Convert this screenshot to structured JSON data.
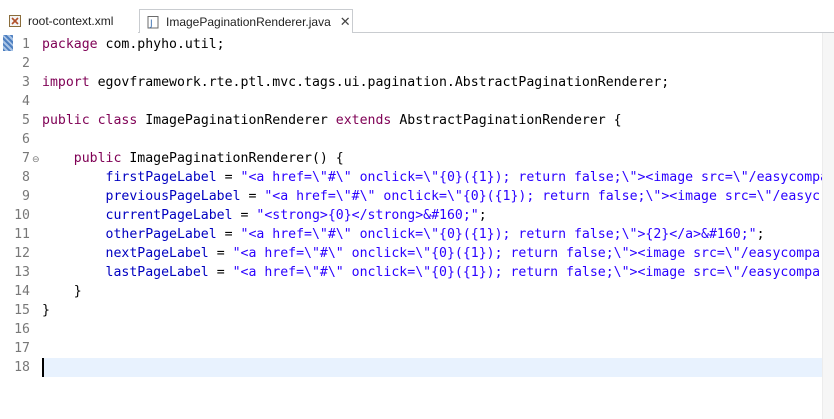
{
  "tabs": [
    {
      "label": "root-context.xml",
      "icon": "xml-file-icon",
      "active": false
    },
    {
      "label": "ImagePaginationRenderer.java",
      "icon": "java-file-icon",
      "active": true,
      "close": "✕"
    }
  ],
  "editor": {
    "current_line": 18,
    "fold_glyph": "⊖",
    "lines": [
      {
        "n": "1",
        "segs": [
          {
            "t": "package",
            "c": "kw"
          },
          {
            "t": " com.phyho.util;",
            "c": ""
          }
        ]
      },
      {
        "n": "2",
        "segs": []
      },
      {
        "n": "3",
        "segs": [
          {
            "t": "import",
            "c": "kw"
          },
          {
            "t": " egovframework.rte.ptl.mvc.tags.ui.pagination.AbstractPaginationRenderer;",
            "c": ""
          }
        ]
      },
      {
        "n": "4",
        "segs": []
      },
      {
        "n": "5",
        "segs": [
          {
            "t": "public",
            "c": "kw"
          },
          {
            "t": " ",
            "c": ""
          },
          {
            "t": "class",
            "c": "kw"
          },
          {
            "t": " ImagePaginationRenderer ",
            "c": ""
          },
          {
            "t": "extends",
            "c": "kw"
          },
          {
            "t": " AbstractPaginationRenderer {",
            "c": ""
          }
        ]
      },
      {
        "n": "6",
        "segs": []
      },
      {
        "n": "7",
        "segs": [
          {
            "t": "    ",
            "c": ""
          },
          {
            "t": "public",
            "c": "kw"
          },
          {
            "t": " ImagePaginationRenderer() {",
            "c": ""
          }
        ]
      },
      {
        "n": "8",
        "segs": [
          {
            "t": "        ",
            "c": ""
          },
          {
            "t": "firstPageLabel",
            "c": "fld"
          },
          {
            "t": " = ",
            "c": ""
          },
          {
            "t": "\"<a href=\\\"#\\\" onclick=\\\"{0}({1}); return false;\\\"><image src=\\\"/easycompa",
            "c": "str"
          }
        ]
      },
      {
        "n": "9",
        "segs": [
          {
            "t": "        ",
            "c": ""
          },
          {
            "t": "previousPageLabel",
            "c": "fld"
          },
          {
            "t": " = ",
            "c": ""
          },
          {
            "t": "\"<a href=\\\"#\\\" onclick=\\\"{0}({1}); return false;\\\"><image src=\\\"/easyc",
            "c": "str"
          }
        ]
      },
      {
        "n": "10",
        "segs": [
          {
            "t": "        ",
            "c": ""
          },
          {
            "t": "currentPageLabel",
            "c": "fld"
          },
          {
            "t": " = ",
            "c": ""
          },
          {
            "t": "\"<strong>{0}</strong>&#160;\"",
            "c": "str"
          },
          {
            "t": ";",
            "c": ""
          }
        ]
      },
      {
        "n": "11",
        "segs": [
          {
            "t": "        ",
            "c": ""
          },
          {
            "t": "otherPageLabel",
            "c": "fld"
          },
          {
            "t": " = ",
            "c": ""
          },
          {
            "t": "\"<a href=\\\"#\\\" onclick=\\\"{0}({1}); return false;\\\">{2}</a>&#160;\"",
            "c": "str"
          },
          {
            "t": ";",
            "c": ""
          }
        ]
      },
      {
        "n": "12",
        "segs": [
          {
            "t": "        ",
            "c": ""
          },
          {
            "t": "nextPageLabel",
            "c": "fld"
          },
          {
            "t": " = ",
            "c": ""
          },
          {
            "t": "\"<a href=\\\"#\\\" onclick=\\\"{0}({1}); return false;\\\"><image src=\\\"/easycompa",
            "c": "str"
          }
        ]
      },
      {
        "n": "13",
        "segs": [
          {
            "t": "        ",
            "c": ""
          },
          {
            "t": "lastPageLabel",
            "c": "fld"
          },
          {
            "t": " = ",
            "c": ""
          },
          {
            "t": "\"<a href=\\\"#\\\" onclick=\\\"{0}({1}); return false;\\\"><image src=\\\"/easycompa",
            "c": "str"
          }
        ]
      },
      {
        "n": "14",
        "segs": [
          {
            "t": "    }",
            "c": ""
          }
        ]
      },
      {
        "n": "15",
        "segs": [
          {
            "t": "}",
            "c": ""
          }
        ]
      },
      {
        "n": "16",
        "segs": []
      },
      {
        "n": "17",
        "segs": []
      },
      {
        "n": "18",
        "segs": []
      }
    ]
  },
  "colors": {
    "keyword": "#7f0055",
    "string": "#2a00ff",
    "field": "#0000c0",
    "current_line_bg": "#e8f2fe"
  }
}
